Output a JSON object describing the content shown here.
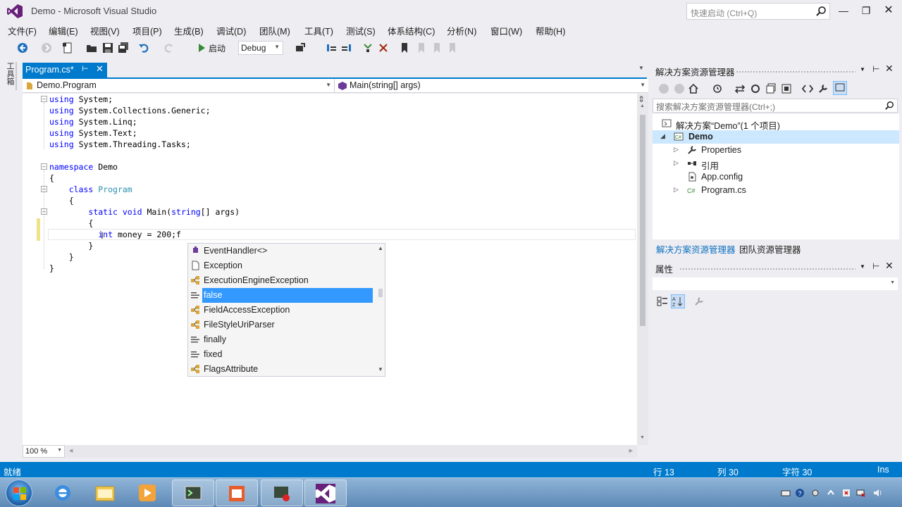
{
  "window": {
    "title": "Demo - Microsoft Visual Studio",
    "quick_launch_placeholder": "快速启动 (Ctrl+Q)"
  },
  "menu": [
    "文件(F)",
    "编辑(E)",
    "视图(V)",
    "项目(P)",
    "生成(B)",
    "调试(D)",
    "团队(M)",
    "工具(T)",
    "测试(S)",
    "体系结构(C)",
    "分析(N)",
    "窗口(W)",
    "帮助(H)"
  ],
  "toolbar": {
    "start_label": "启动",
    "configuration": "Debug"
  },
  "toolbox": {
    "label": "工具箱"
  },
  "document": {
    "tab_name": "Program.cs*",
    "nav_class": "Demo.Program",
    "nav_member": "Main(string[] args)"
  },
  "code": {
    "lines": [
      "using System;",
      "using System.Collections.Generic;",
      "using System.Linq;",
      "using System.Text;",
      "using System.Threading.Tasks;",
      "",
      "namespace Demo",
      "{",
      "    class Program",
      "    {",
      "        static void Main(string[] args)",
      "        {",
      "            int money = 200;f",
      "        }",
      "    }",
      "}"
    ]
  },
  "completion": {
    "items": [
      "EventHandler<>",
      "Exception",
      "ExecutionEngineException",
      "false",
      "FieldAccessException",
      "FileStyleUriParser",
      "finally",
      "fixed",
      "FlagsAttribute"
    ],
    "selected": "false"
  },
  "editor": {
    "zoom": "100 %"
  },
  "solution_explorer": {
    "title": "解决方案资源管理器",
    "search_placeholder": "搜索解决方案资源管理器(Ctrl+;)",
    "solution_label": "解决方案“Demo”(1 个项目)",
    "project": "Demo",
    "items": [
      "Properties",
      "引用",
      "App.config",
      "Program.cs"
    ],
    "tab_active": "解决方案资源管理器",
    "tab_team": "团队资源管理器"
  },
  "properties": {
    "title": "属性"
  },
  "status": {
    "ready": "就绪",
    "line": "行 13",
    "col": "列 30",
    "char": "字符 30",
    "mode": "Ins"
  },
  "colors": {
    "accent": "#007acc",
    "selection": "#3399ff",
    "keyword": "#0000ff",
    "type": "#2b91af"
  }
}
